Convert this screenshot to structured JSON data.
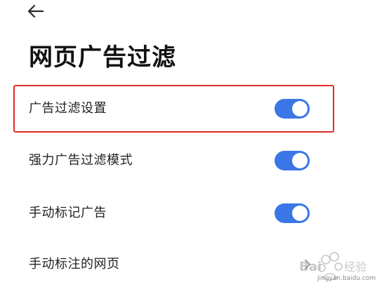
{
  "header": {
    "back_icon": "arrow-left-icon",
    "title": "网页广告过滤"
  },
  "settings": [
    {
      "label": "广告过滤设置",
      "control": "toggle",
      "enabled": true,
      "highlighted": true
    },
    {
      "label": "强力广告过滤模式",
      "control": "toggle",
      "enabled": true
    },
    {
      "label": "手动标记广告",
      "control": "toggle",
      "enabled": true
    },
    {
      "label": "手动标注的网页",
      "control": "chevron-right-icon"
    }
  ],
  "watermark": {
    "brand": "Bai 经验",
    "url": "jingyan.baidu.com"
  },
  "colors": {
    "accent": "#3a76e6",
    "highlight": "#e02b27",
    "text": "#222222",
    "background": "#ffffff"
  }
}
